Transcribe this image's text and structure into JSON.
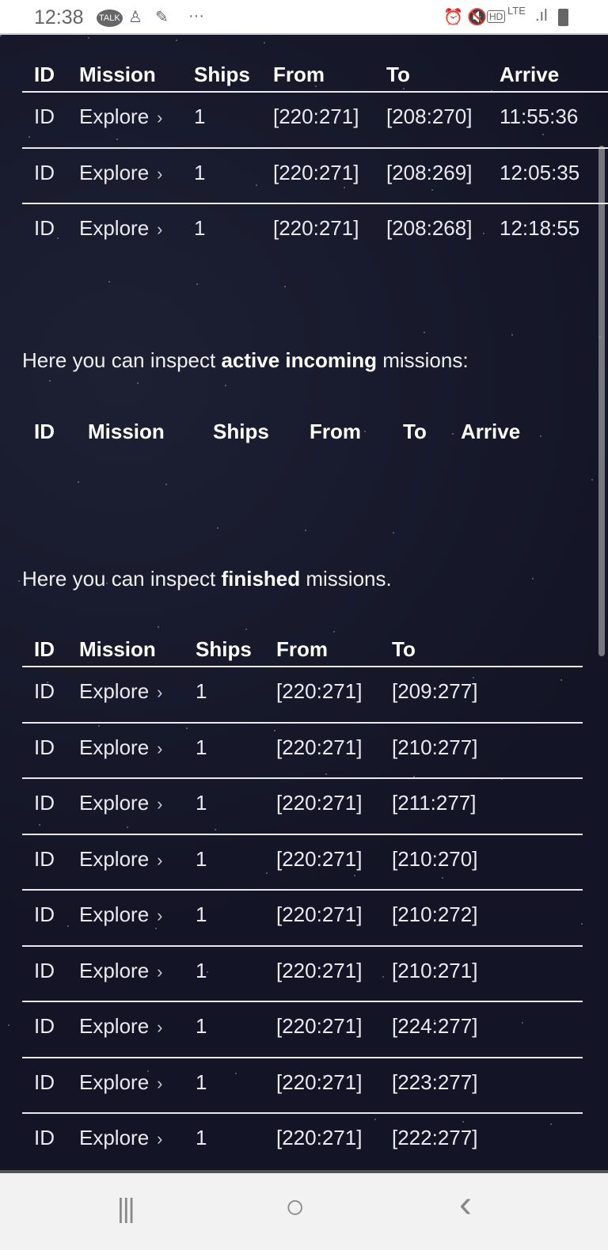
{
  "status_bar": {
    "time": "12:38",
    "left_icons": [
      "talk-icon",
      "person-icon",
      "feather-icon",
      "more-icon"
    ],
    "right_icons": [
      "alarm-icon",
      "mute-icon",
      "hd-icon",
      "lte-icon",
      "signal-icon",
      "battery-icon"
    ],
    "lte": "LTE",
    "hd": "HD",
    "talk": "TALK"
  },
  "outgoing": {
    "headers": [
      "ID",
      "Mission",
      "Ships",
      "From",
      "To",
      "Arrive"
    ],
    "rows": [
      [
        "ID",
        "Explore",
        "1",
        "[220:271]",
        "[208:270]",
        "11:55:36"
      ],
      [
        "ID",
        "Explore",
        "1",
        "[220:271]",
        "[208:269]",
        "12:05:35"
      ],
      [
        "ID",
        "Explore",
        "1",
        "[220:271]",
        "[208:268]",
        "12:18:55"
      ]
    ]
  },
  "incoming": {
    "intro_pre": "Here you can inspect ",
    "intro_bold": "active incoming",
    "intro_post": " missions:",
    "headers": [
      "ID",
      "Mission",
      "Ships",
      "From",
      "To",
      "Arrive"
    ],
    "rows": []
  },
  "finished": {
    "intro_pre": "Here you can inspect ",
    "intro_bold": "finished",
    "intro_post": " missions.",
    "headers": [
      "ID",
      "Mission",
      "Ships",
      "From",
      "To"
    ],
    "rows": [
      [
        "ID",
        "Explore",
        "1",
        "[220:271]",
        "[209:277]"
      ],
      [
        "ID",
        "Explore",
        "1",
        "[220:271]",
        "[210:277]"
      ],
      [
        "ID",
        "Explore",
        "1",
        "[220:271]",
        "[211:277]"
      ],
      [
        "ID",
        "Explore",
        "1",
        "[220:271]",
        "[210:270]"
      ],
      [
        "ID",
        "Explore",
        "1",
        "[220:271]",
        "[210:272]"
      ],
      [
        "ID",
        "Explore",
        "1",
        "[220:271]",
        "[210:271]"
      ],
      [
        "ID",
        "Explore",
        "1",
        "[220:271]",
        "[224:277]"
      ],
      [
        "ID",
        "Explore",
        "1",
        "[220:271]",
        "[223:277]"
      ],
      [
        "ID",
        "Explore",
        "1",
        "[220:271]",
        "[222:277]"
      ]
    ]
  },
  "chevron": "›",
  "nav_bar": {
    "recent": "|||",
    "home": "○",
    "back": "‹"
  }
}
